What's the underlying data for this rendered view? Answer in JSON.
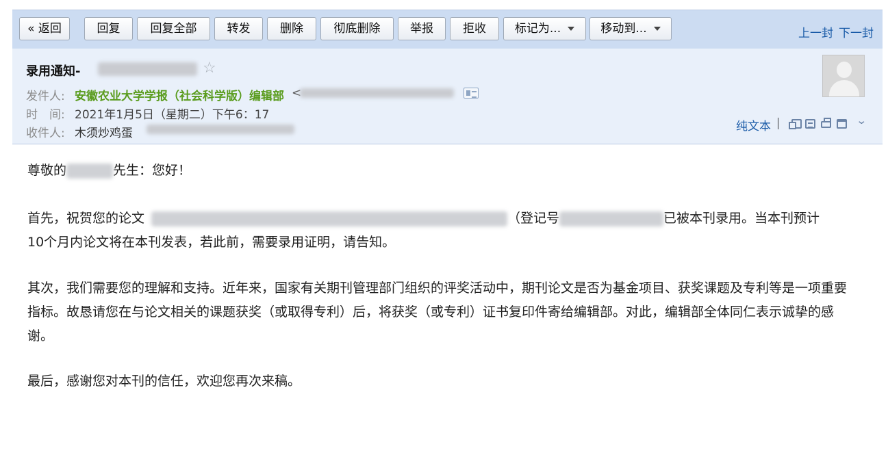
{
  "toolbar": {
    "back": "« 返回",
    "reply": "回复",
    "reply_all": "回复全部",
    "forward": "转发",
    "delete": "删除",
    "delete_forever": "彻底删除",
    "report": "举报",
    "reject": "拒收",
    "mark_as": "标记为...",
    "move_to": "移动到...",
    "prev": "上一封",
    "next": "下一封"
  },
  "mail": {
    "subject": "录用通知-",
    "from_label": "发件人:",
    "from_name": "安徽农业大学学报（社会科学版）编辑部",
    "from_bracket": "<",
    "time_label": "时　间:",
    "time_value": "2021年1月5日（星期二）下午6：17",
    "to_label": "收件人:",
    "to_name": "木须炒鸡蛋",
    "plain_text": "纯文本"
  },
  "body": {
    "greeting_a": "尊敬的",
    "greeting_b": "先生：您好！",
    "p1_a": "首先，祝贺您的论文",
    "p1_b": "（登记号",
    "p1_c": "已被本刊录用。当本刊预计",
    "p1_d": "10个月内论文将在本刊发表，若此前，需要录用证明，请告知。",
    "p2": "其次，我们需要您的理解和支持。近年来，国家有关期刊管理部门组织的评奖活动中，期刊论文是否为基金项目、获奖课题及专利等是一项重要指标。故恳请您在与论文相关的课题获奖（或取得专利）后，将获奖（或专利）证书复印件寄给编辑部。对此，编辑部全体同仁表示诚挚的感谢。",
    "p3": "最后，感谢您对本刊的信任，欢迎您再次来稿。"
  },
  "icons": [
    "star-icon",
    "contact-card-icon",
    "avatar-icon",
    "new-window-icon",
    "note-icon",
    "download-icon",
    "print-icon",
    "expand-chevron-icon"
  ],
  "colors": {
    "toolbar_bg": "#ccdcf2",
    "header_bg": "#e9f0fa",
    "link": "#1a5ba8",
    "sender": "#5a9c1e"
  }
}
